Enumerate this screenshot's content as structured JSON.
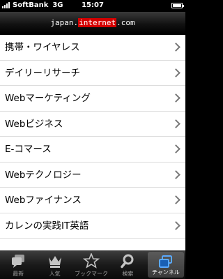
{
  "status_bar": {
    "carrier": "SoftBank",
    "network": "3G",
    "time": "15:07"
  },
  "header": {
    "logo_prefix": "japan.",
    "logo_highlight": "internet",
    "logo_suffix": ".com"
  },
  "list": {
    "items": [
      {
        "label": "携帯・ワイヤレス"
      },
      {
        "label": "デイリーリサーチ"
      },
      {
        "label": "Webマーケティング"
      },
      {
        "label": "Webビジネス"
      },
      {
        "label": "E-コマース"
      },
      {
        "label": "Webテクノロジー"
      },
      {
        "label": "Webファイナンス"
      },
      {
        "label": "カレンの実践IT英語"
      }
    ]
  },
  "tab_bar": {
    "tabs": [
      {
        "label": "最新",
        "icon": "news-icon"
      },
      {
        "label": "人気",
        "icon": "crown-icon"
      },
      {
        "label": "ブックマーク",
        "icon": "star-icon"
      },
      {
        "label": "検索",
        "icon": "search-icon"
      },
      {
        "label": "チャンネル",
        "icon": "channel-icon",
        "active": true
      }
    ]
  }
}
